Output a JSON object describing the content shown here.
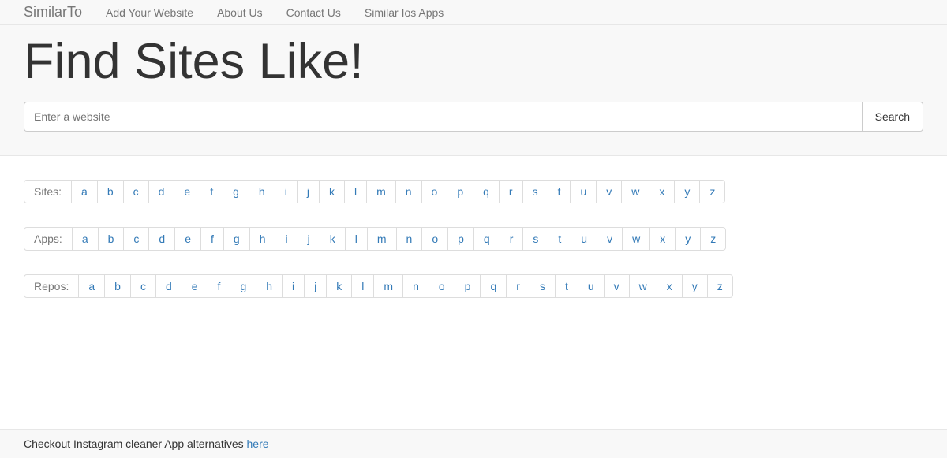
{
  "nav": {
    "brand": "SimilarTo",
    "links": [
      "Add Your Website",
      "About Us",
      "Contact Us",
      "Similar Ios Apps"
    ]
  },
  "hero": {
    "title": "Find Sites Like!",
    "search_placeholder": "Enter a website",
    "search_button": "Search"
  },
  "alpha_rows": [
    {
      "label": "Sites:",
      "items": [
        "a",
        "b",
        "c",
        "d",
        "e",
        "f",
        "g",
        "h",
        "i",
        "j",
        "k",
        "l",
        "m",
        "n",
        "o",
        "p",
        "q",
        "r",
        "s",
        "t",
        "u",
        "v",
        "w",
        "x",
        "y",
        "z"
      ]
    },
    {
      "label": "Apps:",
      "items": [
        "a",
        "b",
        "c",
        "d",
        "e",
        "f",
        "g",
        "h",
        "i",
        "j",
        "k",
        "l",
        "m",
        "n",
        "o",
        "p",
        "q",
        "r",
        "s",
        "t",
        "u",
        "v",
        "w",
        "x",
        "y",
        "z"
      ]
    },
    {
      "label": "Repos:",
      "items": [
        "a",
        "b",
        "c",
        "d",
        "e",
        "f",
        "g",
        "h",
        "i",
        "j",
        "k",
        "l",
        "m",
        "n",
        "o",
        "p",
        "q",
        "r",
        "s",
        "t",
        "u",
        "v",
        "w",
        "x",
        "y",
        "z"
      ]
    }
  ],
  "footer": {
    "text": "Checkout Instagram cleaner App alternatives ",
    "link_text": "here"
  }
}
